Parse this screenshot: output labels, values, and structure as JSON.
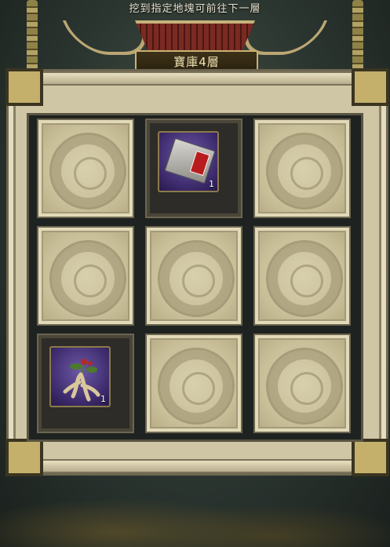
{
  "header": {
    "hint": "挖到指定地塊可前往下一層",
    "floor_title": "寶庫4層"
  },
  "grid": {
    "tiles": [
      {
        "state": "hidden"
      },
      {
        "state": "revealed",
        "item": "scroll-book-icon",
        "qty": "1"
      },
      {
        "state": "hidden"
      },
      {
        "state": "hidden"
      },
      {
        "state": "hidden"
      },
      {
        "state": "hidden"
      },
      {
        "state": "revealed",
        "item": "ginseng-root-icon",
        "qty": "1"
      },
      {
        "state": "hidden"
      },
      {
        "state": "hidden"
      }
    ]
  },
  "colors": {
    "item_bg": "#3c2a6b",
    "title_text": "#f1e3b5",
    "frame": "#cfc6a6"
  }
}
